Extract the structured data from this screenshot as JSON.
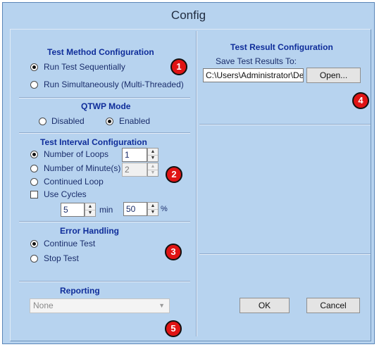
{
  "window": {
    "title": "Config"
  },
  "test_method": {
    "header": "Test Method Configuration",
    "options": [
      "Run Test Sequentially",
      "Run Simultaneously (Multi-Threaded)"
    ],
    "selected": 0
  },
  "qtwp": {
    "header": "QTWP Mode",
    "options": [
      "Disabled",
      "Enabled"
    ],
    "selected": 1
  },
  "interval": {
    "header": "Test Interval Configuration",
    "loops_label": "Number of Loops",
    "loops_value": "1",
    "minutes_label": "Number of Minute(s)",
    "minutes_value": "2",
    "continued_label": "Continued Loop",
    "selected": 0,
    "use_cycles_label": "Use Cycles",
    "use_cycles_checked": false,
    "cycle_minutes_value": "5",
    "cycle_minutes_unit": "min",
    "cycle_percent_value": "50",
    "cycle_percent_unit": "%"
  },
  "error_handling": {
    "header": "Error Handling",
    "options": [
      "Continue Test",
      "Stop Test"
    ],
    "selected": 0
  },
  "reporting": {
    "header": "Reporting",
    "selected_value": "None"
  },
  "results": {
    "header": "Test Result Configuration",
    "save_label": "Save Test Results To:",
    "path_value": "C:\\Users\\Administrator\\Des",
    "open_button": "Open..."
  },
  "buttons": {
    "ok": "OK",
    "cancel": "Cancel"
  },
  "annotations": [
    "1",
    "2",
    "3",
    "4",
    "5"
  ],
  "colors": {
    "window_bg": "#b7d3ef",
    "header_text": "#0f2d9a",
    "badge": "#e01414"
  }
}
